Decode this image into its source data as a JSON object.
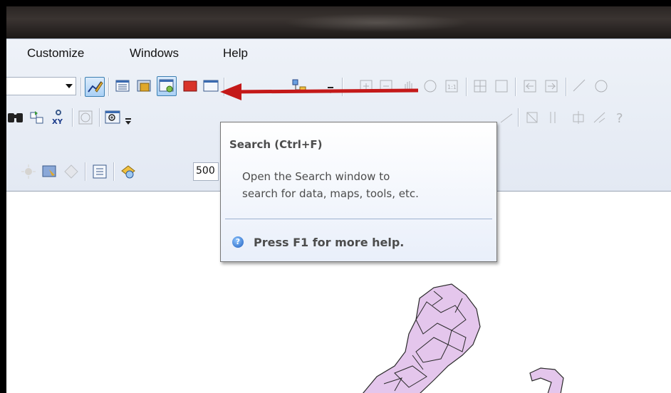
{
  "menubar": {
    "items": [
      "Customize",
      "Windows",
      "Help"
    ]
  },
  "toolbar": {
    "scale_value": "500"
  },
  "tooltip": {
    "title": "Search (Ctrl+F)",
    "body_line1": "Open the Search window to",
    "body_line2": "search for data, maps, tools, etc.",
    "help_text": "Press F1 for more help.",
    "help_icon_glyph": "?"
  },
  "colors": {
    "arrow": "#c41919",
    "polygon_fill": "#e4c6ec",
    "active_tool": "#a9d0f5"
  }
}
